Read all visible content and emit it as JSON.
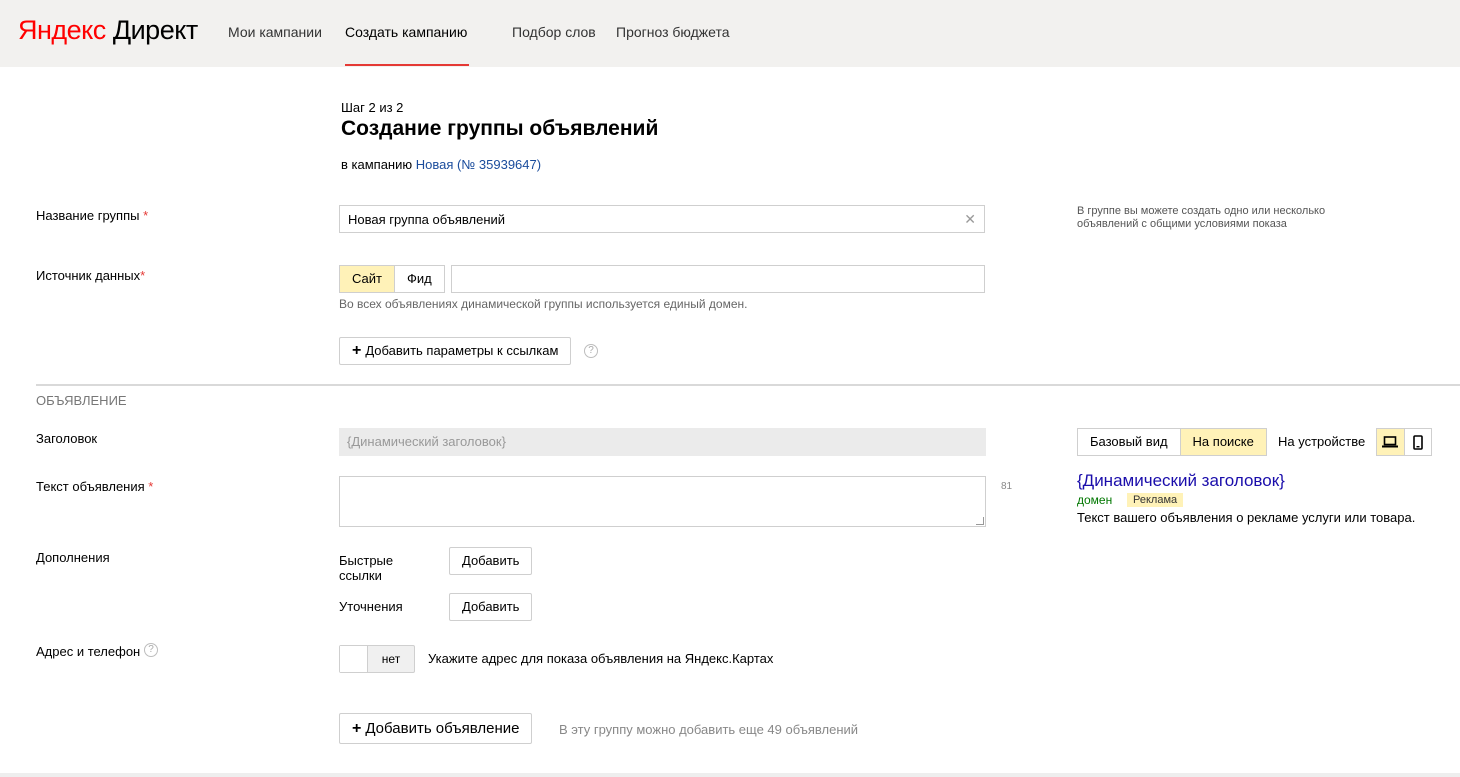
{
  "header": {
    "logo_brand": "Яндекс",
    "logo_product": "Директ",
    "nav": [
      "Мои кампании",
      "Создать кампанию",
      "Подбор слов",
      "Прогноз бюджета"
    ]
  },
  "page": {
    "step": "Шаг 2 из 2",
    "title": "Создание группы объявлений",
    "campaign_prefix": "в кампанию",
    "campaign_link": "Новая (№ 35939647)"
  },
  "group": {
    "name_label": "Название группы",
    "name_value": "Новая группа объявлений",
    "hint": "В группе вы можете создать одно или несколько объявлений с общими условиями показа",
    "source_label": "Источник данных",
    "source_options": [
      "Сайт",
      "Фид"
    ],
    "source_selected": "Сайт",
    "source_value": "",
    "source_note": "Во всех объявлениях динамической группы используется единый домен.",
    "add_params_button": "Добавить параметры к ссылкам"
  },
  "ad": {
    "section_title": "Объявление",
    "headline_label": "Заголовок",
    "headline_placeholder": "{Динамический заголовок}",
    "text_label": "Текст объявления",
    "text_counter": "81",
    "extras_label": "Дополнения",
    "quick_links_label": "Быстрые ссылки",
    "refinements_label": "Уточнения",
    "add_button": "Добавить",
    "address_label": "Адрес и телефон",
    "toggle_value": "нет",
    "toggle_desc": "Укажите адрес для показа объявления на Яндекс.Картах",
    "add_ad_button": "Добавить объявление",
    "add_ad_note": "В эту группу можно добавить еще 49 объявлений"
  },
  "preview": {
    "tabs": [
      "Базовый вид",
      "На поиске"
    ],
    "selected_tab": "На поиске",
    "device_label": "На устройстве",
    "devices": [
      "laptop-icon",
      "phone-icon"
    ],
    "ad_title": "{Динамический заголовок}",
    "ad_domain": "домен",
    "ad_badge": "Реклама",
    "ad_text": "Текст вашего объявления о рекламе услуги или товара."
  },
  "colors": {
    "accent_red": "#e53935",
    "selected_bg": "#fff2b8",
    "link_blue": "#1a4c9c",
    "ad_title_blue": "#1a0dab",
    "ad_domain_green": "#007700"
  }
}
